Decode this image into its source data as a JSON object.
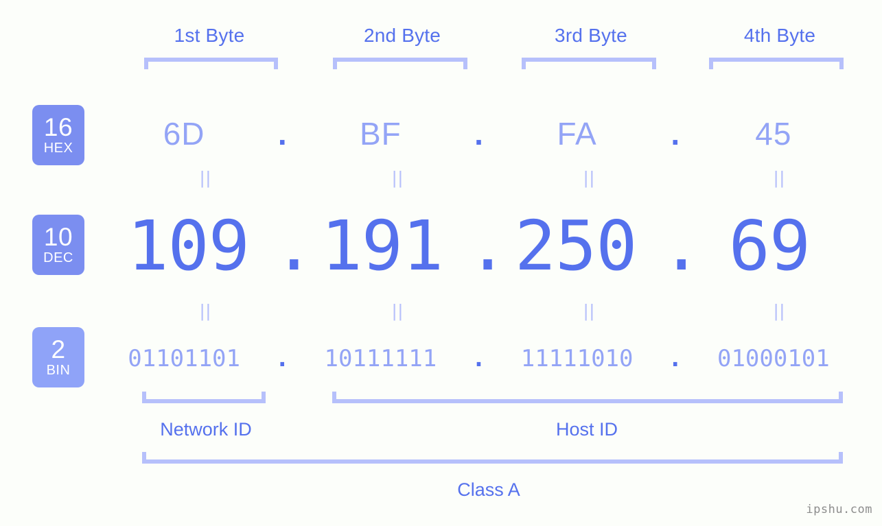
{
  "colors": {
    "background": "#fcfefa",
    "accent_strong": "#5571ed",
    "accent_light": "#93a4f6",
    "bracket": "#b6c0fb",
    "badge_dark": "#7b8ef0",
    "badge_light": "#8fa3f8",
    "watermark": "#8d8d8d"
  },
  "byte_headers": [
    {
      "label": "1st Byte"
    },
    {
      "label": "2nd Byte"
    },
    {
      "label": "3rd Byte"
    },
    {
      "label": "4th Byte"
    }
  ],
  "bases": {
    "hex": {
      "number": "16",
      "name": "HEX"
    },
    "dec": {
      "number": "10",
      "name": "DEC"
    },
    "bin": {
      "number": "2",
      "name": "BIN"
    }
  },
  "separator": ".",
  "equals_symbol": "||",
  "rows": {
    "hex": {
      "base": 16,
      "octets": [
        "6D",
        "BF",
        "FA",
        "45"
      ],
      "full": "6D.BF.FA.45"
    },
    "dec": {
      "base": 10,
      "octets": [
        "109",
        "191",
        "250",
        "69"
      ],
      "full": "109.191.250.69"
    },
    "bin": {
      "base": 2,
      "octets": [
        "01101101",
        "10111111",
        "11111010",
        "01000101"
      ],
      "full": "01101101.10111111.11111010.01000101"
    }
  },
  "segments": {
    "network_id": "Network ID",
    "host_id": "Host ID",
    "class": "Class A"
  },
  "watermark": "ipshu.com"
}
